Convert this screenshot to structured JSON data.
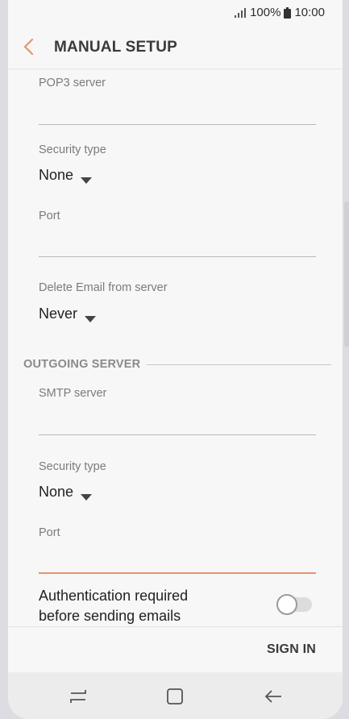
{
  "status_bar": {
    "battery_percent": "100%",
    "time": "10:00",
    "icons": [
      "signal-icon",
      "battery-icon"
    ]
  },
  "header": {
    "title": "MANUAL SETUP",
    "back_icon": "chevron-left-icon"
  },
  "incoming": {
    "pop3_server": {
      "label": "POP3 server",
      "value": ""
    },
    "security_type": {
      "label": "Security type",
      "value": "None"
    },
    "port": {
      "label": "Port",
      "value": ""
    },
    "delete_email": {
      "label": "Delete Email from server",
      "value": "Never"
    }
  },
  "outgoing": {
    "section_title": "OUTGOING SERVER",
    "smtp_server": {
      "label": "SMTP server",
      "value": ""
    },
    "security_type": {
      "label": "Security type",
      "value": "None"
    },
    "port": {
      "label": "Port",
      "value": ""
    },
    "auth": {
      "line1": "Authentication required",
      "line2": "before sending emails",
      "enabled": false
    }
  },
  "footer": {
    "sign_in_label": "SIGN IN"
  },
  "navbar": {
    "icons": [
      "recent-apps-icon",
      "home-icon",
      "back-icon"
    ]
  },
  "colors": {
    "accent": "#e8936c",
    "background": "#f7f7f7",
    "text": "#222222",
    "label": "#7b7b7b"
  }
}
